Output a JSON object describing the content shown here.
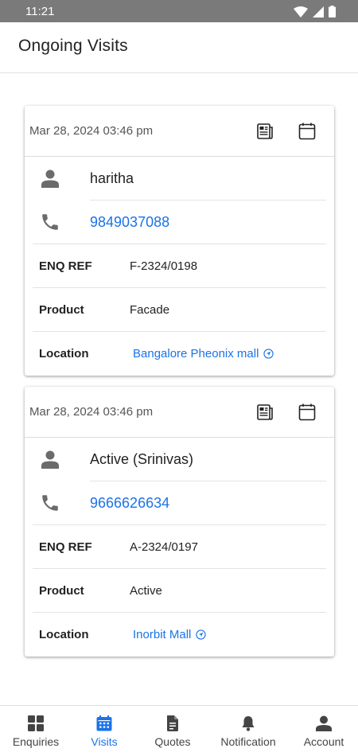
{
  "status_bar": {
    "time": "11:21"
  },
  "header": {
    "title": "Ongoing Visits"
  },
  "visits": [
    {
      "datetime": "Mar 28, 2024 03:46 pm",
      "name": "haritha",
      "phone": "9849037088",
      "enq_ref_label": "ENQ REF",
      "enq_ref": "F-2324/0198",
      "product_label": "Product",
      "product": "Facade",
      "location_label": "Location",
      "location": "Bangalore Pheonix mall"
    },
    {
      "datetime": "Mar 28, 2024 03:46 pm",
      "name": "Active (Srinivas)",
      "phone": "9666626634",
      "enq_ref_label": "ENQ REF",
      "enq_ref": "A-2324/0197",
      "product_label": "Product",
      "product": "Active",
      "location_label": "Location",
      "location": "Inorbit Mall"
    }
  ],
  "bottom_nav": {
    "active": "Visits",
    "items": [
      {
        "label": "Enquiries",
        "icon": "grid-icon"
      },
      {
        "label": "Visits",
        "icon": "calendar-icon"
      },
      {
        "label": "Quotes",
        "icon": "document-icon"
      },
      {
        "label": "Notification",
        "icon": "bell-icon"
      },
      {
        "label": "Account",
        "icon": "person-icon"
      }
    ]
  },
  "colors": {
    "accent": "#1a73e8",
    "status_bar": "#7a7a7a",
    "icon_gray": "#6b6b6b"
  }
}
